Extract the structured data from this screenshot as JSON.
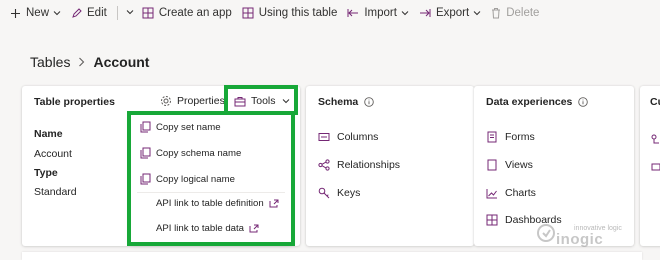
{
  "toolbar": {
    "new": "New",
    "edit": "Edit",
    "create_app": "Create an app",
    "using_table": "Using this table",
    "import": "Import",
    "export": "Export",
    "delete": "Delete"
  },
  "breadcrumb": {
    "parent": "Tables",
    "current": "Account"
  },
  "table_properties": {
    "title": "Table properties",
    "properties_button": "Properties",
    "tools_button": "Tools",
    "fields": [
      {
        "label": "Name",
        "value": "Account"
      },
      {
        "label": "Type",
        "value": "Standard"
      }
    ]
  },
  "tools_menu": {
    "items": [
      {
        "label": "Copy set name",
        "icon": "copy-icon"
      },
      {
        "label": "Copy schema name",
        "icon": "copy-icon"
      },
      {
        "label": "Copy logical name",
        "icon": "copy-icon"
      },
      {
        "label": "API link to table definition",
        "icon": "open-external-icon"
      },
      {
        "label": "API link to table data",
        "icon": "open-external-icon"
      }
    ]
  },
  "schema": {
    "title": "Schema",
    "items": [
      {
        "label": "Columns",
        "icon": "columns-icon"
      },
      {
        "label": "Relationships",
        "icon": "relationships-icon"
      },
      {
        "label": "Keys",
        "icon": "key-icon"
      }
    ]
  },
  "data_experiences": {
    "title": "Data experiences",
    "items": [
      {
        "label": "Forms",
        "icon": "forms-icon"
      },
      {
        "label": "Views",
        "icon": "views-icon"
      },
      {
        "label": "Charts",
        "icon": "charts-icon"
      },
      {
        "label": "Dashboards",
        "icon": "dashboards-icon"
      }
    ]
  },
  "customizations": {
    "title": "Cu"
  },
  "watermark": {
    "tagline": "innovative logic",
    "brand": "inogic"
  },
  "colors": {
    "accent": "#742774",
    "highlight": "#17a838"
  }
}
